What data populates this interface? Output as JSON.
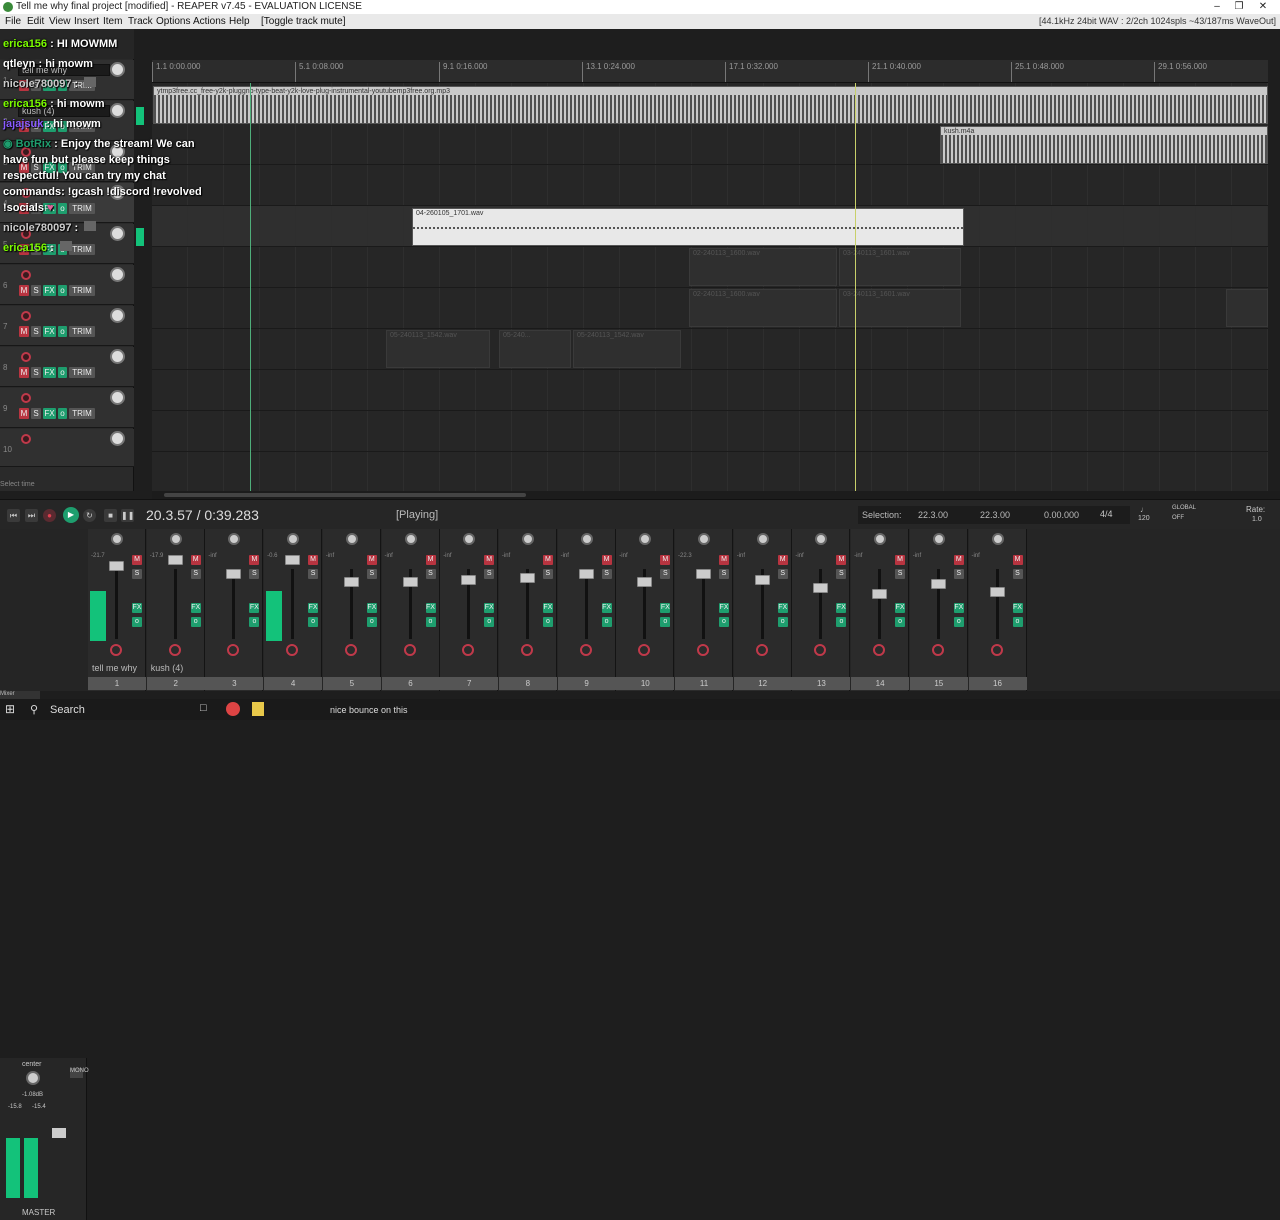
{
  "window": {
    "title": "Tell me why final project [modified] - REAPER v7.45 - EVALUATION LICENSE"
  },
  "menu": {
    "items": [
      "File",
      "Edit",
      "View",
      "Insert",
      "Item",
      "Track",
      "Options",
      "Actions",
      "Help",
      "[Toggle track mute]"
    ],
    "status": "[44.1kHz 24bit WAV : 2/2ch 1024spls ~43/187ms WaveOut]"
  },
  "ruler": {
    "marks": [
      "1.1\n0:00.000",
      "5.1\n0:08.000",
      "9.1\n0:16.000",
      "13.1\n0:24.000",
      "17.1\n0:32.000",
      "21.1\n0:40.000",
      "25.1\n0:48.000",
      "29.1\n0:56.000"
    ]
  },
  "tracks": [
    {
      "num": "1",
      "name": "tell me why"
    },
    {
      "num": "2",
      "name": "kush (4)"
    },
    {
      "num": "3",
      "name": ""
    },
    {
      "num": "4",
      "name": ""
    },
    {
      "num": "5",
      "name": ""
    },
    {
      "num": "6",
      "name": ""
    },
    {
      "num": "7",
      "name": ""
    },
    {
      "num": "8",
      "name": ""
    },
    {
      "num": "9",
      "name": ""
    },
    {
      "num": "10",
      "name": ""
    }
  ],
  "items": [
    {
      "label": "ytmp3free.cc_free-y2k-pluggnb-type-beat-y2k-love-plug-instrumental-youtubemp3free.org.mp3"
    },
    {
      "label": "kush.m4a"
    },
    {
      "label": "04-260105_1701.wav"
    },
    {
      "label": "02-240113_1600.wav"
    },
    {
      "label": "03-240113_1601.wav"
    },
    {
      "label": "02-240113_1600.wav"
    },
    {
      "label": "03-240113_1601.wav"
    },
    {
      "label": "05-240113_1542.wav"
    },
    {
      "label": "05-240..."
    },
    {
      "label": "05-240113_1542.wav"
    }
  ],
  "chat": [
    {
      "user": "erica156",
      "msg": "HI MOWMM",
      "color": "#7CFC00"
    },
    {
      "user": "qtleyn",
      "msg": "hi mowm",
      "color": "#ffffff"
    },
    {
      "user": "nicole780097",
      "msg": "",
      "color": "#cccccc"
    },
    {
      "user": "erica156",
      "msg": "hi mowm",
      "color": "#7CFC00"
    },
    {
      "user": "jajajsuk",
      "msg": "hi mowm",
      "color": "#8a5cff"
    },
    {
      "user": "BotRix",
      "msg": "Enjoy the stream! We can have fun but please keep things respectful! You can try my chat commands: !gcash !discord !revolved !socials",
      "color": "#1e9e6e"
    },
    {
      "user": "nicole780097",
      "msg": "",
      "color": "#cccccc"
    },
    {
      "user": "erica156",
      "msg": "",
      "color": "#7CFC00"
    }
  ],
  "transport": {
    "position": "20.3.57 / 0:39.283",
    "state": "[Playing]",
    "selection_label": "Selection:",
    "sel_start": "22.3.00",
    "sel_end": "22.3.00",
    "sel_len": "0.00.000",
    "timesig": "4/4",
    "bpm": "120",
    "rate_label": "Rate:",
    "rate": "1.0",
    "select_time": "Select time",
    "global": "GLOBAL",
    "off": "OFF"
  },
  "mixer": {
    "master_label": "MASTER",
    "master_pan": "center",
    "master_db": "-1.08dB",
    "master_l": "-15.8",
    "master_r": "-15.4",
    "strips": [
      {
        "num": "1",
        "name": "tell me why",
        "db": "-21.7"
      },
      {
        "num": "2",
        "name": "kush (4)",
        "db": "-17.9"
      },
      {
        "num": "3",
        "name": "",
        "db": "-inf"
      },
      {
        "num": "4",
        "name": "",
        "db": "-0.6"
      },
      {
        "num": "5",
        "name": "",
        "db": "-inf"
      },
      {
        "num": "6",
        "name": "",
        "db": "-inf"
      },
      {
        "num": "7",
        "name": "",
        "db": "-inf"
      },
      {
        "num": "8",
        "name": "",
        "db": "-inf"
      },
      {
        "num": "9",
        "name": "",
        "db": "-inf"
      },
      {
        "num": "10",
        "name": "",
        "db": "-inf"
      },
      {
        "num": "11",
        "name": "",
        "db": "-22.3"
      },
      {
        "num": "12",
        "name": "",
        "db": "-inf"
      },
      {
        "num": "13",
        "name": "",
        "db": "-inf"
      },
      {
        "num": "14",
        "name": "",
        "db": "-inf"
      },
      {
        "num": "15",
        "name": "",
        "db": "-inf"
      },
      {
        "num": "16",
        "name": "",
        "db": "-inf"
      }
    ],
    "tab": "Mixer"
  },
  "taskbar": {
    "search": "Search",
    "notify": "nice bounce on this"
  },
  "colors": {
    "accent": "#1e9e6e",
    "mute": "#b83440",
    "play_cursor": "#c8d06a",
    "edit_cursor": "#4fae7a"
  }
}
